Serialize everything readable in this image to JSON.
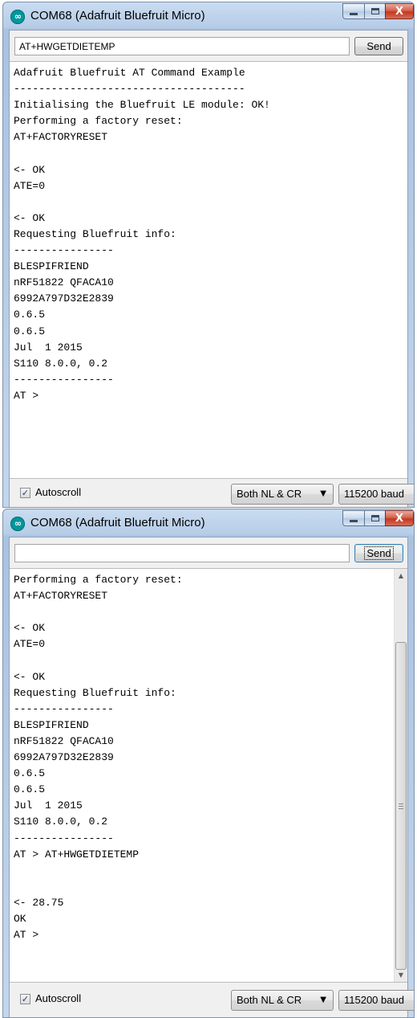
{
  "window1": {
    "title": "COM68 (Adafruit Bluefruit Micro)",
    "app_icon": "arduino-infinity-icon",
    "close_glyph": "X",
    "input_value": "AT+HWGETDIETEMP",
    "input_placeholder": "",
    "send_label": "Send",
    "lines": [
      "Adafruit Bluefruit AT Command Example",
      "-------------------------------------",
      "Initialising the Bluefruit LE module: OK!",
      "Performing a factory reset:",
      "AT+FACTORYRESET",
      "",
      "<- OK",
      "ATE=0",
      "",
      "<- OK",
      "Requesting Bluefruit info:",
      "----------------",
      "BLESPIFRIEND",
      "nRF51822 QFACA10",
      "6992A797D32E2839",
      "0.6.5",
      "0.6.5",
      "Jul  1 2015",
      "S110 8.0.0, 0.2",
      "----------------",
      "AT >"
    ],
    "autoscroll_label": "Autoscroll",
    "autoscroll_checked": true,
    "line_ending": "Both NL & CR",
    "baud": "115200 baud"
  },
  "window2": {
    "title": "COM68 (Adafruit Bluefruit Micro)",
    "app_icon": "arduino-infinity-icon",
    "close_glyph": "X",
    "input_value": "",
    "input_placeholder": "",
    "send_label": "Send",
    "lines": [
      "Performing a factory reset:",
      "AT+FACTORYRESET",
      "",
      "<- OK",
      "ATE=0",
      "",
      "<- OK",
      "Requesting Bluefruit info:",
      "----------------",
      "BLESPIFRIEND",
      "nRF51822 QFACA10",
      "6992A797D32E2839",
      "0.6.5",
      "0.6.5",
      "Jul  1 2015",
      "S110 8.0.0, 0.2",
      "----------------",
      "AT > AT+HWGETDIETEMP",
      "",
      "",
      "<- 28.75",
      "OK",
      "AT >"
    ],
    "autoscroll_label": "Autoscroll",
    "autoscroll_checked": true,
    "line_ending": "Both NL & CR",
    "baud": "115200 baud"
  },
  "glyphs": {
    "check": "✓",
    "combo_arrow": "▼",
    "scroll_up": "▲",
    "scroll_down": "▼"
  },
  "colors": {
    "arduino_teal": "#00979c",
    "close_red": "#c4381f",
    "titlebar_blue": "#b7cde8"
  }
}
